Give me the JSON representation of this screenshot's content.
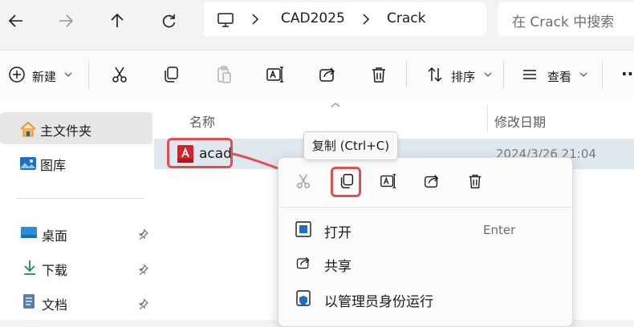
{
  "address": {
    "segments": [
      "CAD2025",
      "Crack"
    ],
    "search_placeholder": "在 Crack 中搜索"
  },
  "toolbar": {
    "new_label": "新建",
    "sort_label": "排序",
    "view_label": "查看",
    "more_label": "··"
  },
  "sidebar": {
    "items": [
      {
        "label": "主文件夹",
        "icon": "home-icon",
        "selected": true
      },
      {
        "label": "图库",
        "icon": "gallery-icon"
      },
      {
        "label": "桌面",
        "icon": "desktop-icon",
        "pinned": true
      },
      {
        "label": "下载",
        "icon": "download-icon",
        "pinned": true
      },
      {
        "label": "文档",
        "icon": "documents-icon",
        "pinned": true
      }
    ]
  },
  "file_list": {
    "columns": [
      "名称",
      "修改日期"
    ],
    "rows": [
      {
        "name": "acad",
        "modified": "2024/3/26 21:04",
        "icon": "autocad-app-icon"
      }
    ]
  },
  "context_menu": {
    "items": [
      {
        "label": "打开",
        "shortcut": "Enter",
        "icon": "open-icon"
      },
      {
        "label": "共享",
        "icon": "share-icon"
      },
      {
        "label": "以管理员身份运行",
        "icon": "shield-icon"
      }
    ]
  },
  "tooltip": {
    "text": "复制 (Ctrl+C)"
  },
  "colors": {
    "highlight": "#e05050",
    "accent": "#0067c0",
    "autocad_red": "#d8202c"
  }
}
